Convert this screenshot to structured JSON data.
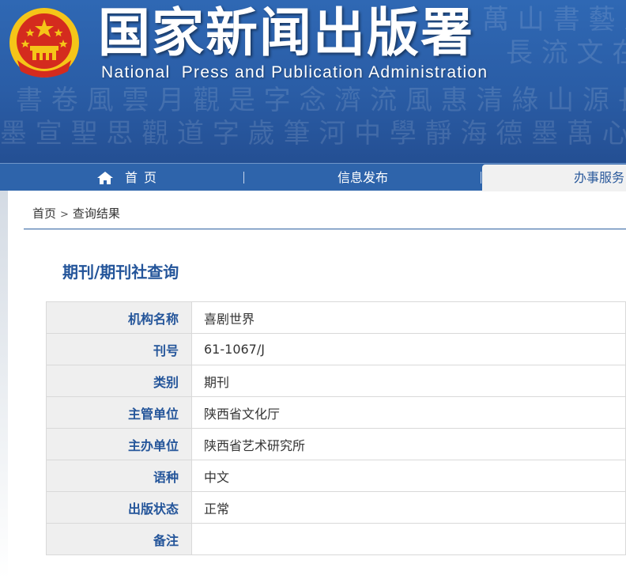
{
  "header": {
    "title": "国家新闻出版署",
    "subtitle": "National  Press and Publication Administration"
  },
  "nav": {
    "home": "首页",
    "news": "信息发布",
    "service": "办事服务"
  },
  "breadcrumb": {
    "home": "首页",
    "separator": ">",
    "current": "查询结果"
  },
  "section_title": "期刊/期刊社查询",
  "record": {
    "rows": [
      {
        "label": "机构名称",
        "value": "喜剧世界"
      },
      {
        "label": "刊号",
        "value": "61-1067/J"
      },
      {
        "label": "类别",
        "value": "期刊"
      },
      {
        "label": "主管单位",
        "value": "陕西省文化厅"
      },
      {
        "label": "主办单位",
        "value": "陕西省艺术研究所"
      },
      {
        "label": "语种",
        "value": "中文"
      },
      {
        "label": "出版状态",
        "value": "正常"
      },
      {
        "label": "备注",
        "value": ""
      }
    ]
  },
  "colors": {
    "banner_blue": "#2a5da6",
    "accent_blue": "#24559a",
    "label_bg": "#efefef",
    "emblem_red": "#d42b1e",
    "emblem_gold": "#f5c518"
  },
  "icons": {
    "emblem": "national-emblem",
    "home": "home-icon"
  }
}
